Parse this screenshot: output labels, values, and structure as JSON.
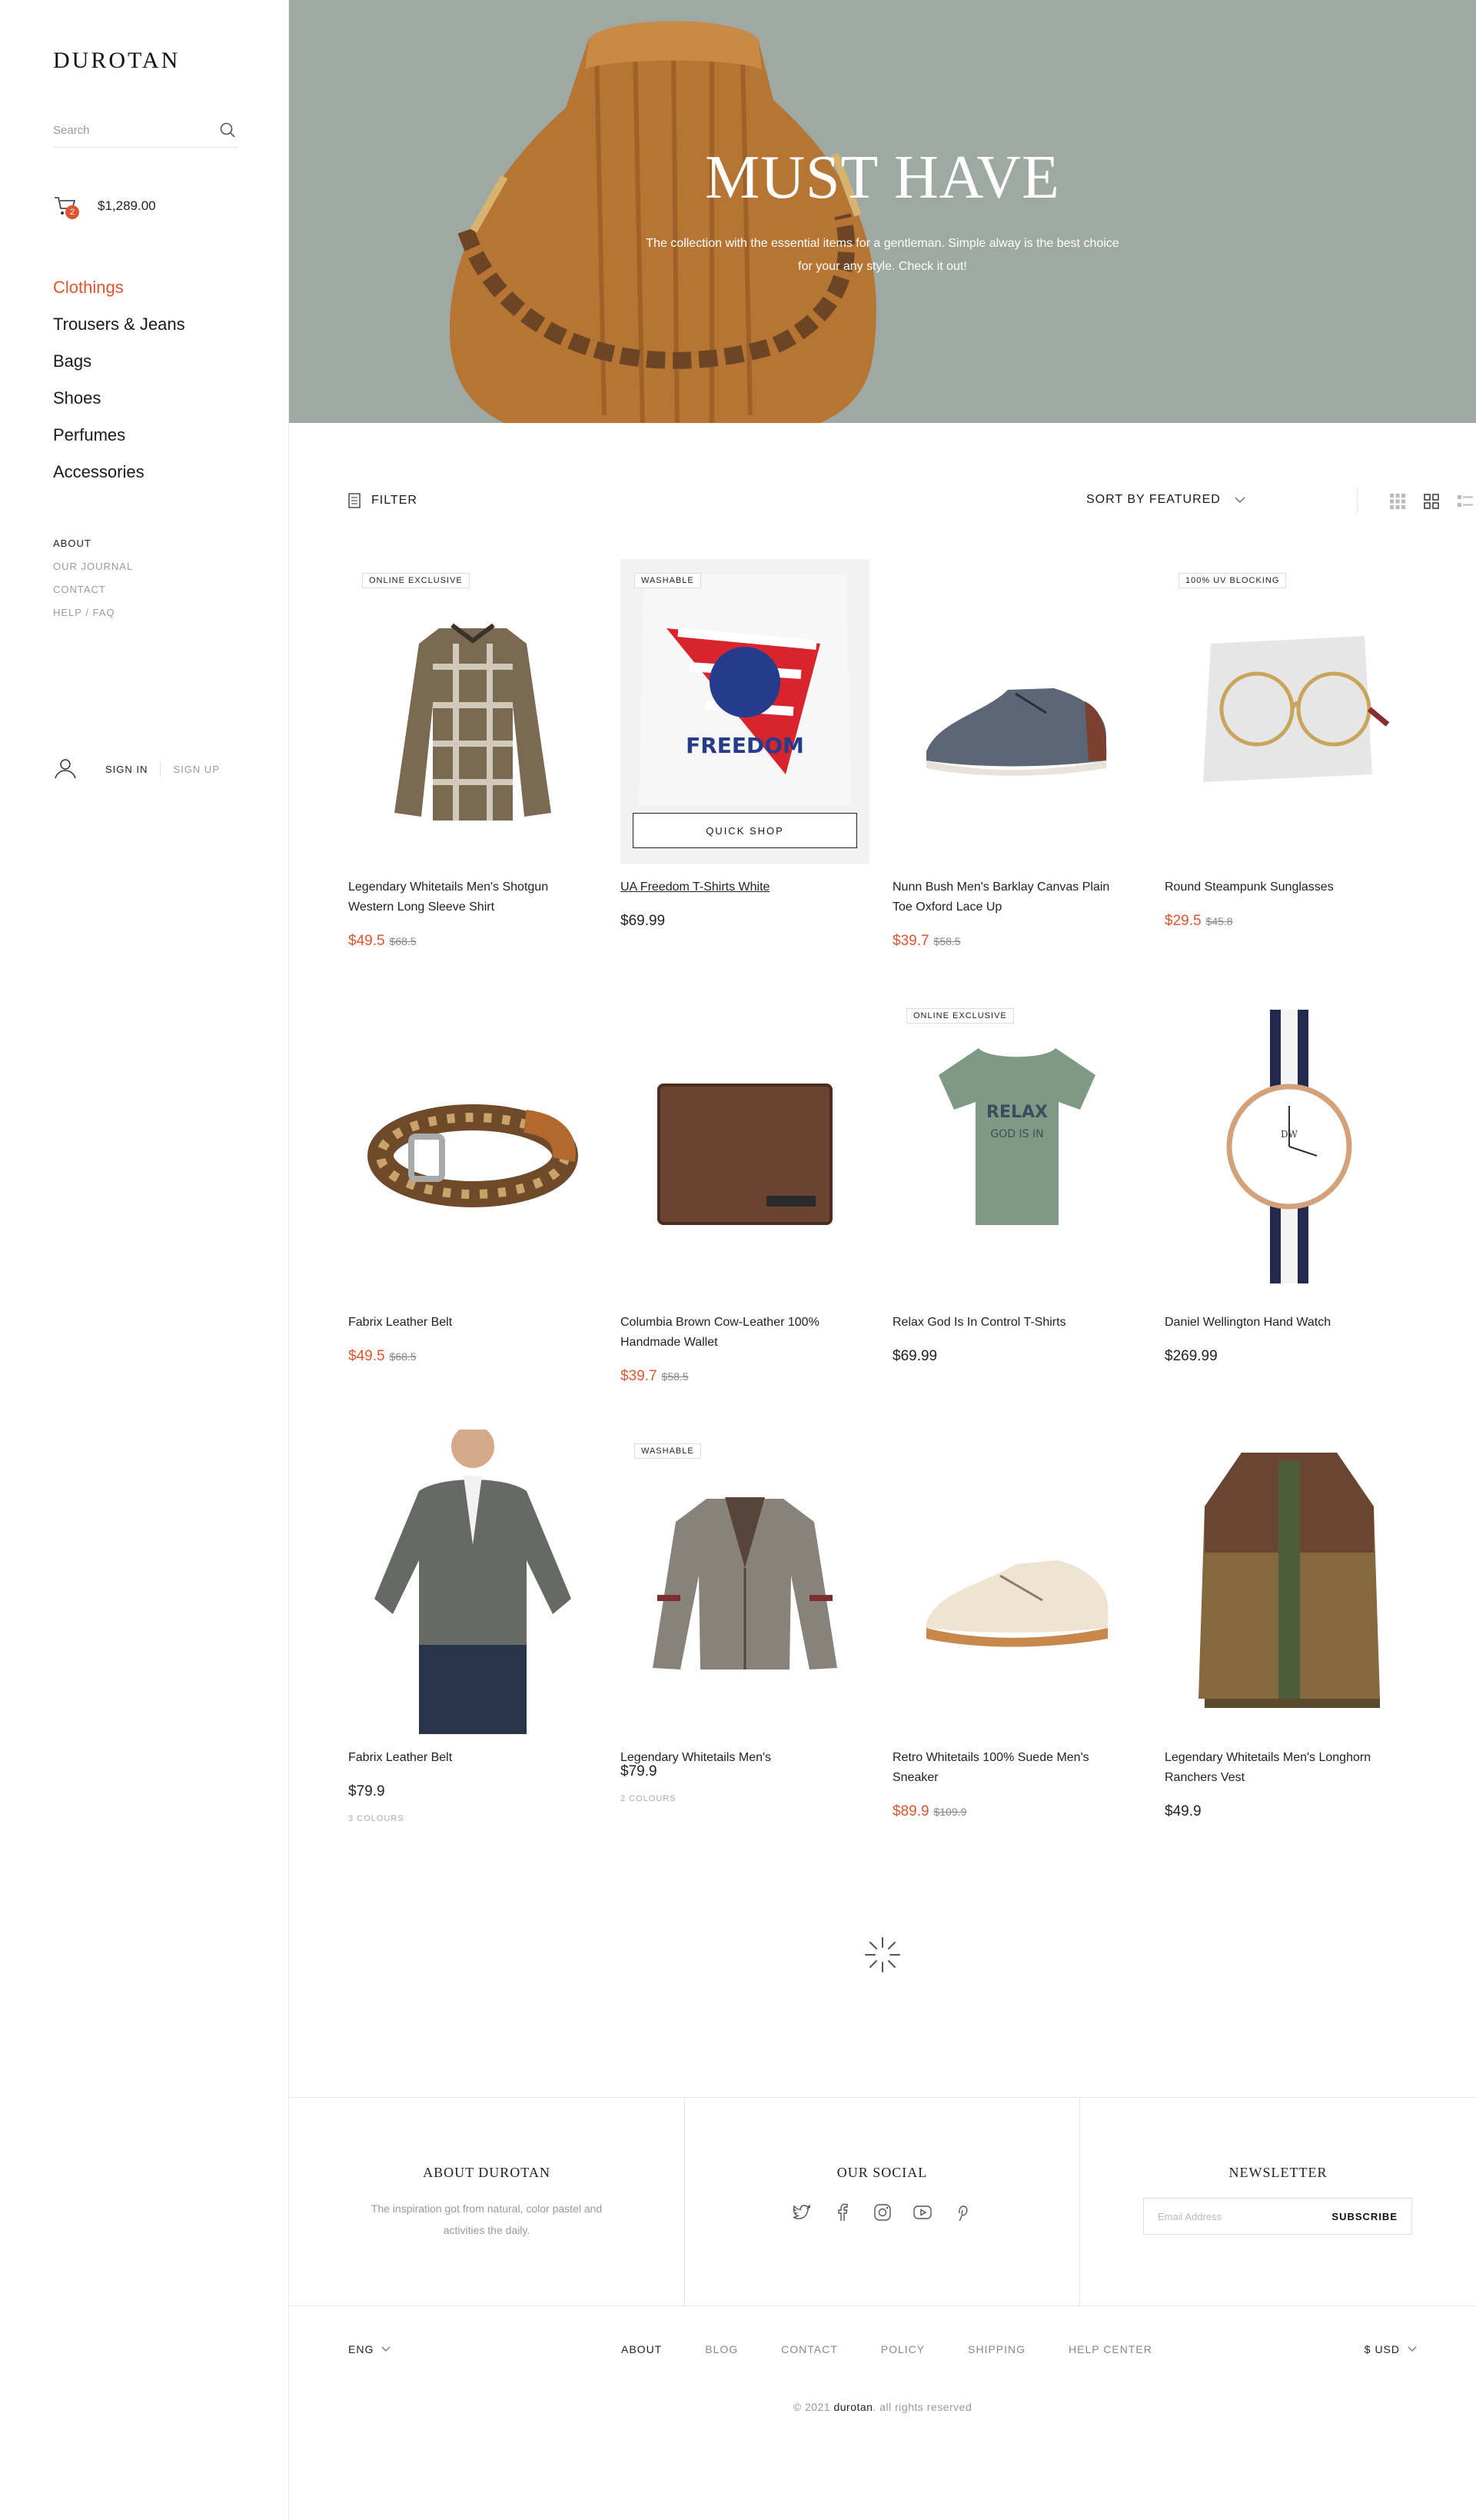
{
  "brand": {
    "logo": "DUROTAN"
  },
  "search": {
    "placeholder": "Search"
  },
  "cart": {
    "count": "2",
    "total": "$1,289.00"
  },
  "categories": [
    "Clothings",
    "Trousers & Jeans",
    "Bags",
    "Shoes",
    "Perfumes",
    "Accessories"
  ],
  "info_links": [
    "ABOUT",
    "OUR JOURNAL",
    "CONTACT",
    "HELP / FAQ"
  ],
  "account": {
    "sign_in": "SIGN IN",
    "sign_up": "SIGN UP"
  },
  "hero": {
    "title": "MUST HAVE",
    "text": "The collection with the essential items for a gentleman. Simple alway is the best choice for your any style. Check it out!"
  },
  "toolbar": {
    "filter": "FILTER",
    "sort": "SORT BY FEATURED"
  },
  "colors": {
    "accent": "#e0552f",
    "hero_bg": "#9ea9a3"
  },
  "products": [
    {
      "name": "Legendary Whitetails Men's Shotgun Western Long Sleeve Shirt",
      "price": "$49.5",
      "old_price": "$68.5",
      "tag": "ONLINE EXCLUSIVE"
    },
    {
      "name": "UA Freedom T-Shirts White",
      "price": "$69.99",
      "tag": "WASHABLE",
      "quick_shop": "QUICK SHOP"
    },
    {
      "name": "Nunn Bush Men's Barklay Canvas Plain Toe Oxford Lace Up",
      "price": "$39.7",
      "old_price": "$58.5"
    },
    {
      "name": "Round Steampunk Sunglasses",
      "price": "$29.5",
      "old_price": "$45.8",
      "tag": "100% UV BLOCKING"
    },
    {
      "name": "Fabrix Leather Belt",
      "price": "$49.5",
      "old_price": "$68.5"
    },
    {
      "name": "Columbia Brown Cow-Leather 100% Handmade Wallet",
      "price": "$39.7",
      "old_price": "$58.5"
    },
    {
      "name": "Relax God Is In Control T-Shirts",
      "price": "$69.99",
      "tag": "ONLINE EXCLUSIVE"
    },
    {
      "name": "Daniel Wellington Hand Watch",
      "price": "$269.99"
    },
    {
      "name": "Fabrix Leather Belt",
      "price": "$79.9",
      "colours": "3 COLOURS"
    },
    {
      "name": "Legendary Whitetails Men's",
      "price": "$79.9",
      "colours": "2 COLOURS",
      "tag": "WASHABLE"
    },
    {
      "name": "Retro Whitetails 100% Suede Men's Sneaker",
      "price": "$89.9",
      "old_price": "$109.9"
    },
    {
      "name": "Legendary Whitetails Men's Longhorn Ranchers Vest",
      "price": "$49.9"
    }
  ],
  "footer": {
    "about_title": "ABOUT DUROTAN",
    "about_text": "The inspiration got from natural, color pastel and activities the daily.",
    "social_title": "OUR SOCIAL",
    "social_icons": [
      "twitter-icon",
      "facebook-icon",
      "instagram-icon",
      "youtube-icon",
      "pinterest-icon"
    ],
    "newsletter_title": "NEWSLETTER",
    "email_placeholder": "Email Address",
    "subscribe": "SUBSCRIBE",
    "language": "ENG",
    "nav": [
      "ABOUT",
      "BLOG",
      "CONTACT",
      "POLICY",
      "SHIPPING",
      "HELP CENTER"
    ],
    "currency": "$ USD",
    "copyright_prefix": "© 2021 ",
    "copyright_brand": "durotan",
    "copyright_suffix": ". all rights reserved"
  }
}
